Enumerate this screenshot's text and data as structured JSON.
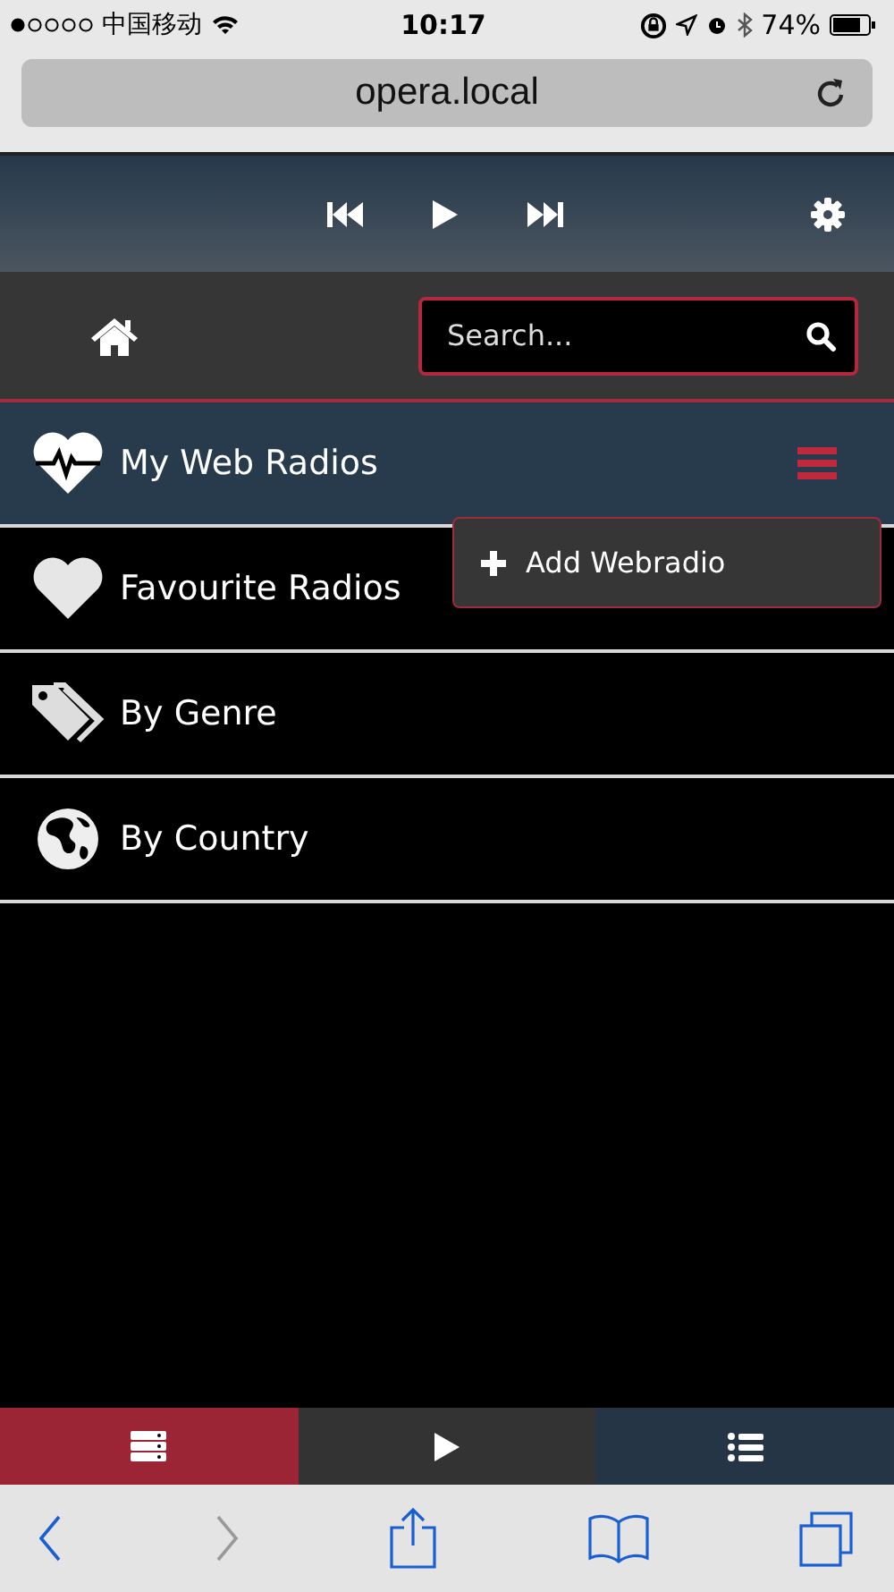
{
  "status_bar": {
    "carrier": "中国移动",
    "time": "10:17",
    "battery": "74%"
  },
  "address_bar": {
    "url": "opera.local"
  },
  "search": {
    "placeholder": "Search..."
  },
  "menu_items": [
    {
      "label": "My Web Radios",
      "kind": "heartbeat",
      "selected": true
    },
    {
      "label": "Favourite Radios",
      "kind": "heart",
      "selected": false
    },
    {
      "label": "By Genre",
      "kind": "tags",
      "selected": false
    },
    {
      "label": "By Country",
      "kind": "globe",
      "selected": false
    }
  ],
  "dropdown": {
    "items": [
      {
        "label": "Add Webradio"
      }
    ]
  },
  "bottom_tabs": [
    {
      "kind": "server",
      "color": "#9b2535"
    },
    {
      "kind": "play",
      "color": "#333333"
    },
    {
      "kind": "list",
      "color": "#253546"
    }
  ],
  "browser_nav": {
    "back_disabled": false,
    "forward_disabled": true
  }
}
